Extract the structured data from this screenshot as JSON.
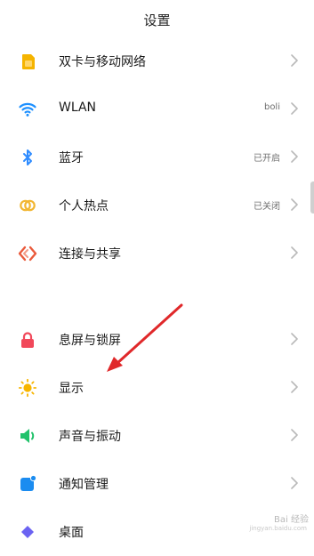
{
  "header": {
    "title": "设置"
  },
  "items": [
    {
      "label": "双卡与移动网络",
      "value": "",
      "icon": "sim-card-icon",
      "color": "#f5b400"
    },
    {
      "label": "WLAN",
      "value": "boli",
      "icon": "wifi-icon",
      "color": "#1e90ff"
    },
    {
      "label": "蓝牙",
      "value": "已开启",
      "icon": "bluetooth-icon",
      "color": "#2f8cff"
    },
    {
      "label": "个人热点",
      "value": "已关闭",
      "icon": "hotspot-icon",
      "color": "#f2b632"
    },
    {
      "label": "连接与共享",
      "value": "",
      "icon": "connection-sharing-icon",
      "color": "#ea5a3b"
    },
    {
      "label": "息屏与锁屏",
      "value": "",
      "icon": "lock-icon",
      "color": "#f1485a"
    },
    {
      "label": "显示",
      "value": "",
      "icon": "sun-icon",
      "color": "#f7b500"
    },
    {
      "label": "声音与振动",
      "value": "",
      "icon": "speaker-icon",
      "color": "#22c26b"
    },
    {
      "label": "通知管理",
      "value": "",
      "icon": "notification-icon",
      "color": "#1b8cf0"
    },
    {
      "label": "桌面",
      "value": "",
      "icon": "desktop-icon",
      "color": "#6b63f2"
    }
  ],
  "watermark": {
    "text": "Bai 经验",
    "sub": "jingyan.baidu.com"
  },
  "annotation": {
    "arrow_color": "#e0282a"
  }
}
